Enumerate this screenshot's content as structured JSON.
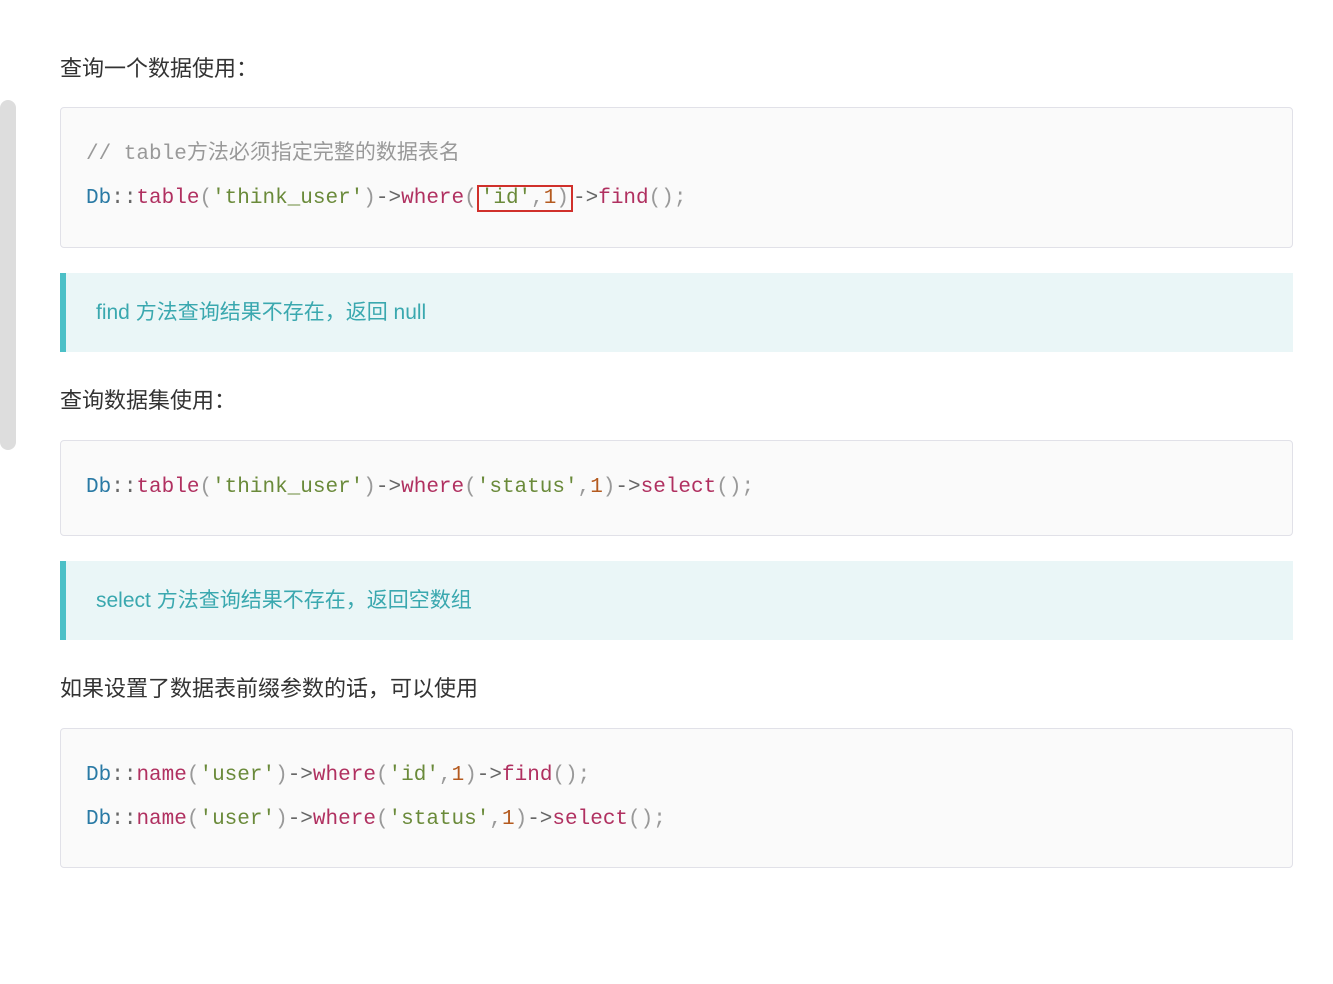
{
  "paragraphs": {
    "p1": "查询一个数据使用：",
    "p2": "查询数据集使用：",
    "p3": "如果设置了数据表前缀参数的话，可以使用"
  },
  "notes": {
    "n1": "find 方法查询结果不存在，返回 null",
    "n2": "select 方法查询结果不存在，返回空数组"
  },
  "code1": {
    "comment": "// table方法必须指定完整的数据表名",
    "class": "Db",
    "dcolon": "::",
    "table": "table",
    "lp1": "(",
    "tablename": "'think_user'",
    "rp1": ")",
    "arrow1": "->",
    "where": "where",
    "lp2": "(",
    "id": "'id'",
    "comma": ",",
    "one": "1",
    "rp2": ")",
    "arrow2": "->",
    "find": "find",
    "lp3": "(",
    "rp3": ")",
    "semi": ";"
  },
  "code2": {
    "class": "Db",
    "dcolon": "::",
    "table": "table",
    "lp1": "(",
    "tablename": "'think_user'",
    "rp1": ")",
    "arrow1": "->",
    "where": "where",
    "lp2": "(",
    "status": "'status'",
    "comma": ",",
    "one": "1",
    "rp2": ")",
    "arrow2": "->",
    "select": "select",
    "lp3": "(",
    "rp3": ")",
    "semi": ";"
  },
  "code3": {
    "class": "Db",
    "dcolon": "::",
    "name": "name",
    "lp1": "(",
    "user": "'user'",
    "rp1": ")",
    "arrow1": "->",
    "where": "where",
    "lp2": "(",
    "id": "'id'",
    "status": "'status'",
    "comma": ",",
    "one": "1",
    "rp2": ")",
    "arrow2": "->",
    "find": "find",
    "select": "select",
    "lp3": "(",
    "rp3": ")",
    "semi": ";"
  }
}
